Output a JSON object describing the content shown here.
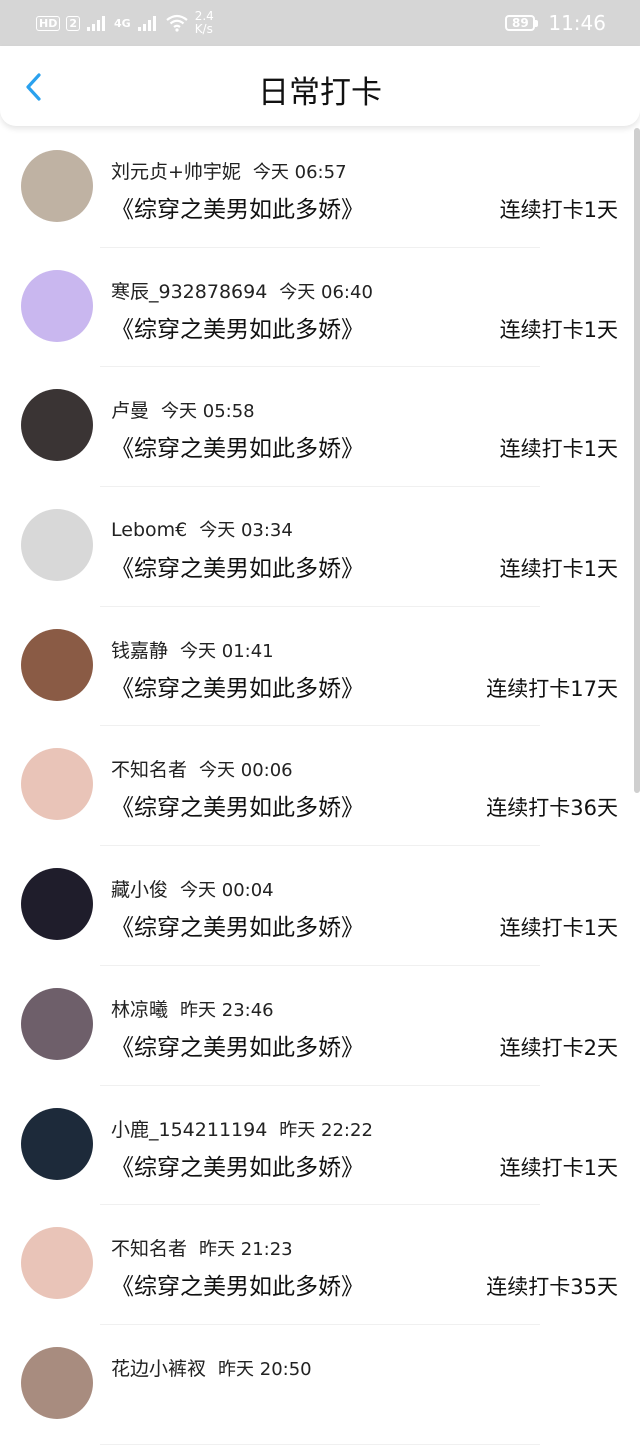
{
  "status_bar": {
    "hd_label": "HD",
    "sim_label": "2",
    "network_label": "4G",
    "speed_value": "2.4",
    "speed_unit": "K/s",
    "battery": "89",
    "time": "11:46"
  },
  "header": {
    "title": "日常打卡"
  },
  "entries": [
    {
      "name": "刘元贞+帅宇妮",
      "time": "今天 06:57",
      "book": "《综穿之美男如此多娇》",
      "streak": "连续打卡1天",
      "avatar_color": "#bfb2a3"
    },
    {
      "name": "寒辰_932878694",
      "time": "今天 06:40",
      "book": "《综穿之美男如此多娇》",
      "streak": "连续打卡1天",
      "avatar_color": "#c9b7ef"
    },
    {
      "name": "卢曼",
      "time": "今天 05:58",
      "book": "《综穿之美男如此多娇》",
      "streak": "连续打卡1天",
      "avatar_color": "#3a3434"
    },
    {
      "name": "Lebom€",
      "time": "今天 03:34",
      "book": "《综穿之美男如此多娇》",
      "streak": "连续打卡1天",
      "avatar_color": "#d8d8d8"
    },
    {
      "name": "钱嘉静",
      "time": "今天 01:41",
      "book": "《综穿之美男如此多娇》",
      "streak": "连续打卡17天",
      "avatar_color": "#8a5b45"
    },
    {
      "name": "不知名者",
      "time": "今天 00:06",
      "book": "《综穿之美男如此多娇》",
      "streak": "连续打卡36天",
      "avatar_color": "#e9c4b8"
    },
    {
      "name": "藏小俊",
      "time": "今天 00:04",
      "book": "《综穿之美男如此多娇》",
      "streak": "连续打卡1天",
      "avatar_color": "#1f1d2b"
    },
    {
      "name": "林凉曦",
      "time": "昨天 23:46",
      "book": "《综穿之美男如此多娇》",
      "streak": "连续打卡2天",
      "avatar_color": "#6e5f6a"
    },
    {
      "name": "小鹿_154211194",
      "time": "昨天 22:22",
      "book": "《综穿之美男如此多娇》",
      "streak": "连续打卡1天",
      "avatar_color": "#1d2a3a"
    },
    {
      "name": "不知名者",
      "time": "昨天 21:23",
      "book": "《综穿之美男如此多娇》",
      "streak": "连续打卡35天",
      "avatar_color": "#e9c4b8"
    },
    {
      "name": "花边小裤衩",
      "time": "昨天 20:50",
      "book": "",
      "streak": "",
      "avatar_color": "#a88c7f"
    }
  ]
}
